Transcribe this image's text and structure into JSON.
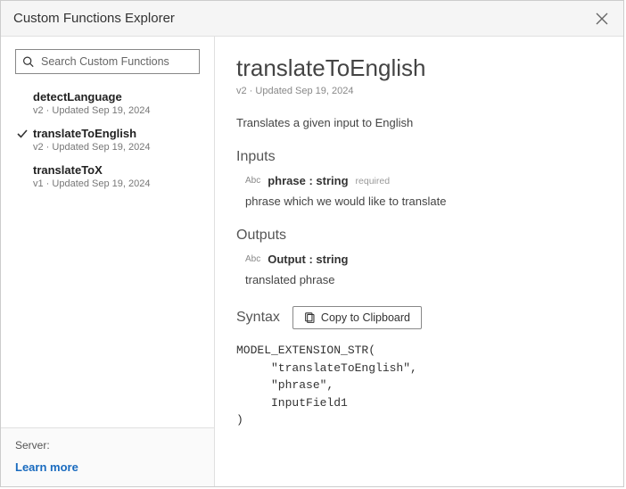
{
  "titlebar": {
    "title": "Custom Functions Explorer"
  },
  "search": {
    "placeholder": "Search Custom Functions"
  },
  "functions": [
    {
      "name": "detectLanguage",
      "meta": "v2 · Updated Sep 19, 2024",
      "selected": false
    },
    {
      "name": "translateToEnglish",
      "meta": "v2 · Updated Sep 19, 2024",
      "selected": true
    },
    {
      "name": "translateToX",
      "meta": "v1 · Updated Sep 19, 2024",
      "selected": false
    }
  ],
  "sidebar_footer": {
    "server_label": "Server:",
    "learn_more": "Learn more"
  },
  "detail": {
    "title": "translateToEnglish",
    "meta": "v2 · Updated Sep 19, 2024",
    "description": "Translates a given input to English",
    "inputs_heading": "Inputs",
    "inputs": [
      {
        "type_badge": "Abc",
        "name_sig": "phrase : string",
        "required_label": "required",
        "desc": "phrase which we would like to translate"
      }
    ],
    "outputs_heading": "Outputs",
    "outputs": [
      {
        "type_badge": "Abc",
        "name_sig": "Output : string",
        "desc": "translated phrase"
      }
    ],
    "syntax_heading": "Syntax",
    "copy_label": "Copy to Clipboard",
    "code": "MODEL_EXTENSION_STR(\n     \"translateToEnglish\",\n     \"phrase\",\n     InputField1\n)"
  }
}
